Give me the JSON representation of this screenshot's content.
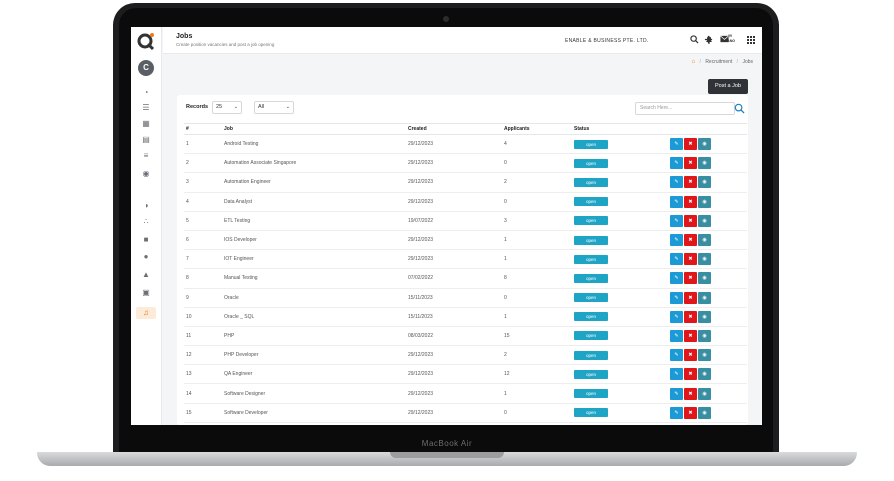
{
  "device": {
    "brand": "MacBook Air"
  },
  "sidebar": {
    "avatar_letter": "C",
    "icons": [
      "dashboard-icon",
      "users-icon",
      "calendar-icon",
      "document-icon",
      "list-icon",
      "profile-icon",
      "chart-icon",
      "network-icon",
      "briefcase-icon",
      "chat-icon",
      "thumbs-up-icon",
      "file-icon",
      "recruitment-icon"
    ],
    "active_index": 12
  },
  "topbar": {
    "title": "Jobs",
    "subtitle": "Create position vacancies and post a job opening",
    "company": "ENABLE & BUSINESS PTE. LTD.",
    "lang_line1": "मर",
    "lang_line2": "LANG"
  },
  "breadcrumb": {
    "section": "Recruitment",
    "current": "Jobs"
  },
  "post_button": "Post a Job",
  "filters": {
    "records_label": "Records",
    "records_value": "25",
    "status_value": "All",
    "search_placeholder": "Search Here..."
  },
  "table": {
    "headers": {
      "no": "#",
      "job": "Job",
      "created": "Created",
      "applicants": "Applicants",
      "status": "Status"
    },
    "rows": [
      {
        "no": "1",
        "job": "Android Testing",
        "created": "29/12/2023",
        "applicants": "4",
        "status": "open"
      },
      {
        "no": "2",
        "job": "Automation Associate Singapore",
        "created": "29/12/2023",
        "applicants": "0",
        "status": "open"
      },
      {
        "no": "3",
        "job": "Automation Engineer",
        "created": "29/12/2023",
        "applicants": "2",
        "status": "open"
      },
      {
        "no": "4",
        "job": "Data Analyst",
        "created": "29/12/2023",
        "applicants": "0",
        "status": "open"
      },
      {
        "no": "5",
        "job": "ETL Testing",
        "created": "19/07/2022",
        "applicants": "3",
        "status": "open"
      },
      {
        "no": "6",
        "job": "IOS Developer",
        "created": "29/12/2023",
        "applicants": "1",
        "status": "open"
      },
      {
        "no": "7",
        "job": "IOT Engineer",
        "created": "29/12/2023",
        "applicants": "1",
        "status": "open"
      },
      {
        "no": "8",
        "job": "Manual Testing",
        "created": "07/02/2022",
        "applicants": "8",
        "status": "open"
      },
      {
        "no": "9",
        "job": "Oracle",
        "created": "15/11/2023",
        "applicants": "0",
        "status": "open"
      },
      {
        "no": "10",
        "job": "Oracle _ SQL",
        "created": "15/11/2023",
        "applicants": "1",
        "status": "open"
      },
      {
        "no": "11",
        "job": "PHP",
        "created": "08/03/2022",
        "applicants": "15",
        "status": "open"
      },
      {
        "no": "12",
        "job": "PHP Developer",
        "created": "29/12/2023",
        "applicants": "2",
        "status": "open"
      },
      {
        "no": "13",
        "job": "QA Engineer",
        "created": "29/12/2023",
        "applicants": "12",
        "status": "open"
      },
      {
        "no": "14",
        "job": "Software Designer",
        "created": "29/12/2023",
        "applicants": "1",
        "status": "open"
      },
      {
        "no": "15",
        "job": "Software Developer",
        "created": "29/12/2023",
        "applicants": "0",
        "status": "open"
      }
    ],
    "action_icons": [
      "edit-icon",
      "delete-icon",
      "view-icon"
    ]
  },
  "colors": {
    "accent": "#f07a1a",
    "status_open": "#1ea4c5",
    "edit": "#1c9ad6",
    "delete": "#e0161b",
    "view": "#3a8ea1"
  }
}
